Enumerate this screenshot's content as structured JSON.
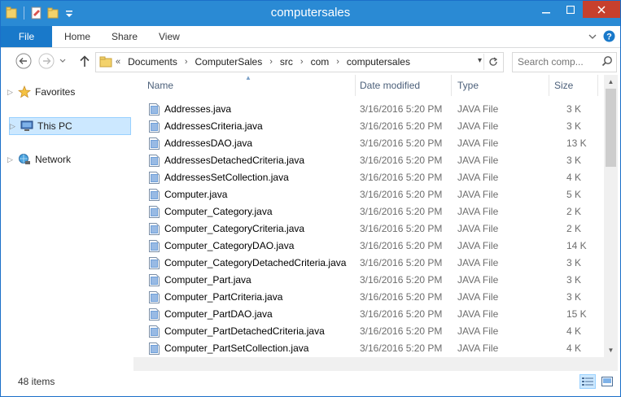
{
  "window": {
    "title": "computersales"
  },
  "ribbon": {
    "tabs": [
      "File",
      "Home",
      "Share",
      "View"
    ]
  },
  "address": {
    "crumbs": [
      "Documents",
      "ComputerSales",
      "src",
      "com",
      "computersales"
    ],
    "overflow": "«"
  },
  "search": {
    "placeholder": "Search comp..."
  },
  "nav": {
    "items": [
      {
        "label": "Favorites",
        "icon": "star-icon"
      },
      {
        "label": "This PC",
        "icon": "computer-icon",
        "selected": true
      },
      {
        "label": "Network",
        "icon": "network-icon"
      }
    ]
  },
  "columns": {
    "name": "Name",
    "date": "Date modified",
    "type": "Type",
    "size": "Size"
  },
  "files": [
    {
      "name": "Addresses.java",
      "date": "3/16/2016 5:20 PM",
      "type": "JAVA File",
      "size": "3 K"
    },
    {
      "name": "AddressesCriteria.java",
      "date": "3/16/2016 5:20 PM",
      "type": "JAVA File",
      "size": "3 K"
    },
    {
      "name": "AddressesDAO.java",
      "date": "3/16/2016 5:20 PM",
      "type": "JAVA File",
      "size": "13 K"
    },
    {
      "name": "AddressesDetachedCriteria.java",
      "date": "3/16/2016 5:20 PM",
      "type": "JAVA File",
      "size": "3 K"
    },
    {
      "name": "AddressesSetCollection.java",
      "date": "3/16/2016 5:20 PM",
      "type": "JAVA File",
      "size": "4 K"
    },
    {
      "name": "Computer.java",
      "date": "3/16/2016 5:20 PM",
      "type": "JAVA File",
      "size": "5 K"
    },
    {
      "name": "Computer_Category.java",
      "date": "3/16/2016 5:20 PM",
      "type": "JAVA File",
      "size": "2 K"
    },
    {
      "name": "Computer_CategoryCriteria.java",
      "date": "3/16/2016 5:20 PM",
      "type": "JAVA File",
      "size": "2 K"
    },
    {
      "name": "Computer_CategoryDAO.java",
      "date": "3/16/2016 5:20 PM",
      "type": "JAVA File",
      "size": "14 K"
    },
    {
      "name": "Computer_CategoryDetachedCriteria.java",
      "date": "3/16/2016 5:20 PM",
      "type": "JAVA File",
      "size": "3 K"
    },
    {
      "name": "Computer_Part.java",
      "date": "3/16/2016 5:20 PM",
      "type": "JAVA File",
      "size": "3 K"
    },
    {
      "name": "Computer_PartCriteria.java",
      "date": "3/16/2016 5:20 PM",
      "type": "JAVA File",
      "size": "3 K"
    },
    {
      "name": "Computer_PartDAO.java",
      "date": "3/16/2016 5:20 PM",
      "type": "JAVA File",
      "size": "15 K"
    },
    {
      "name": "Computer_PartDetachedCriteria.java",
      "date": "3/16/2016 5:20 PM",
      "type": "JAVA File",
      "size": "4 K"
    },
    {
      "name": "Computer_PartSetCollection.java",
      "date": "3/16/2016 5:20 PM",
      "type": "JAVA File",
      "size": "4 K"
    }
  ],
  "status": {
    "count": "48 items"
  },
  "colors": {
    "titlebar": "#2a8ad4",
    "file_tab": "#1979ca",
    "close": "#c7402d",
    "selection": "#cce8ff"
  }
}
